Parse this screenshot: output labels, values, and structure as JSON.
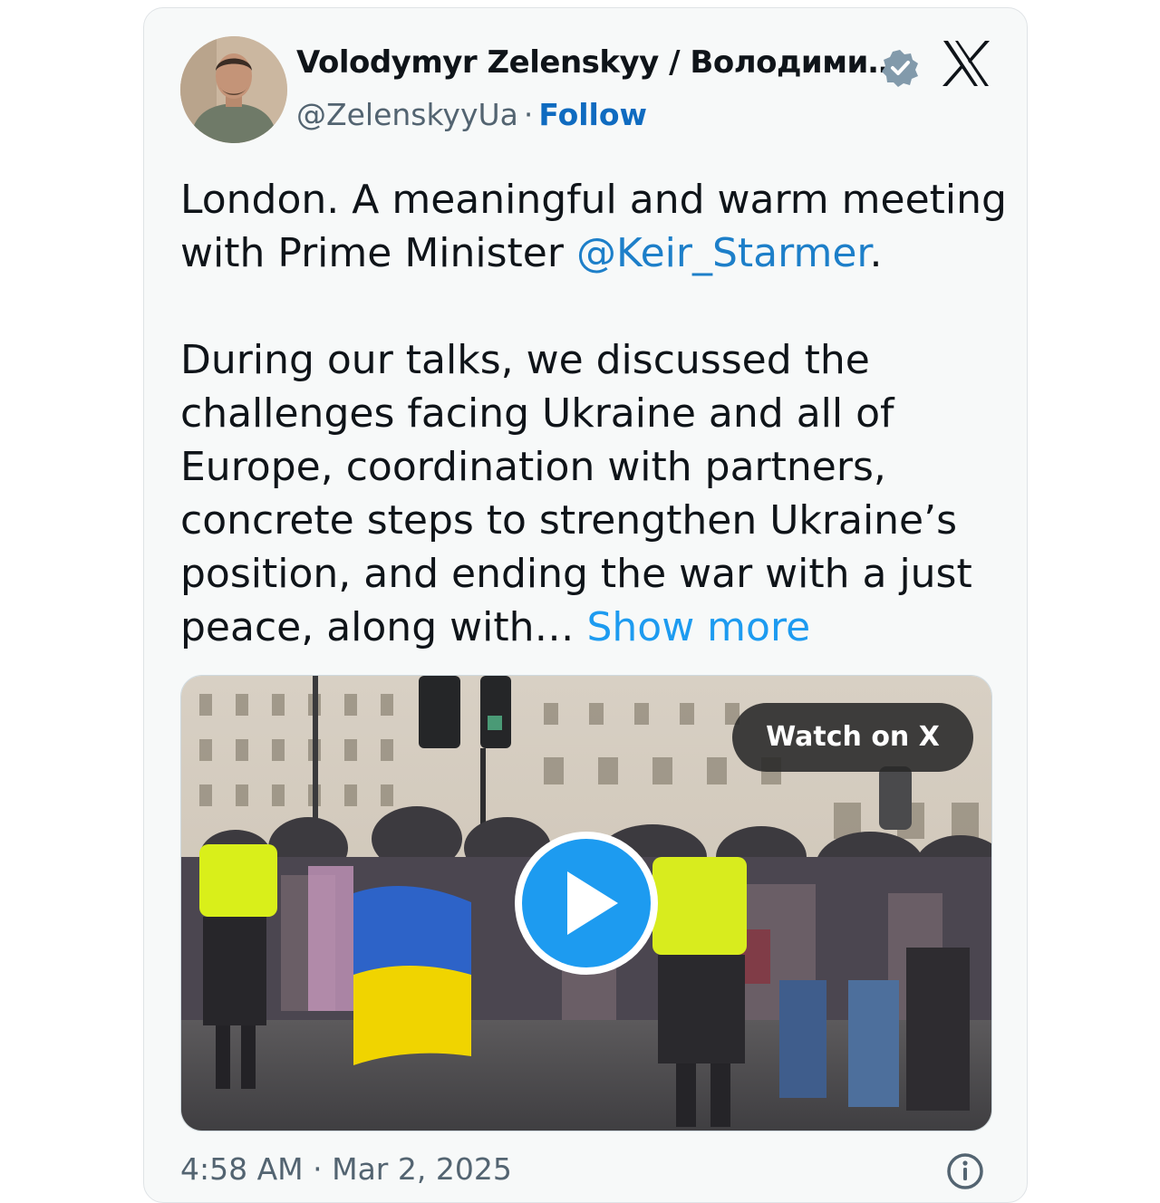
{
  "author": {
    "name": "Volodymyr Zelenskyy / Володими…",
    "handle": "@ZelenskyyUa",
    "separator": "·",
    "follow_label": "Follow"
  },
  "icons": {
    "verified": "verified-badge-icon",
    "brand": "x-logo-icon",
    "play": "play-icon",
    "info": "info-icon"
  },
  "tweet": {
    "line1": "London. A meaningful and warm meeting\nwith Prime Minister ",
    "mention": "@Keir_Starmer",
    "after_mention": ".\n\nDuring our talks, we discussed the\nchallenges facing Ukraine and all of\nEurope, coordination with partners,\nconcrete steps to strengthen Ukraine’s\nposition, and ending the war with a just\npeace, along with… ",
    "show_more": "Show more"
  },
  "media": {
    "watch_label": "Watch on X"
  },
  "footer": {
    "timestamp": "4:58 AM · Mar 2, 2025"
  },
  "colors": {
    "link": "#1d9bf0",
    "follow": "#0f6bc0",
    "text": "#0f1419",
    "muted": "#536471"
  }
}
